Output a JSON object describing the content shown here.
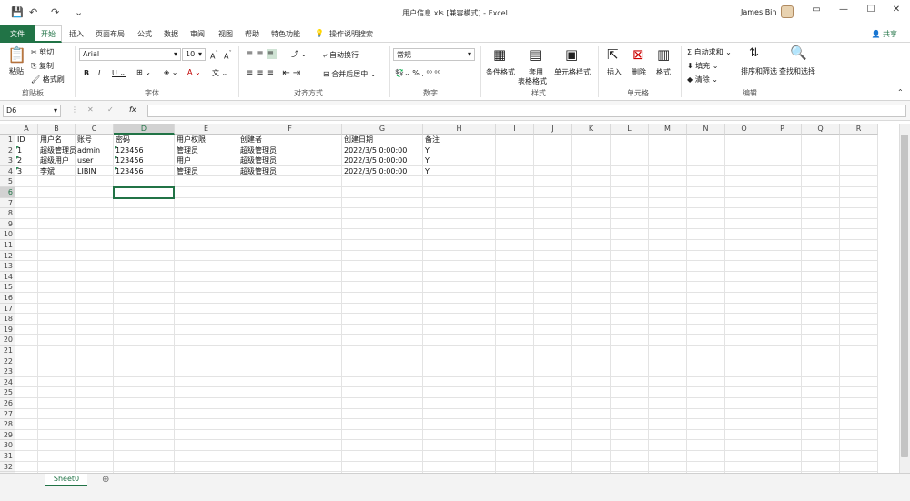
{
  "window": {
    "title": "用户信息.xls  [兼容模式]  -  Excel",
    "user": "James Bin",
    "controls": [
      "▭",
      "—",
      "☐",
      "✕"
    ]
  },
  "quick_access": [
    "💾",
    "↶",
    "↷",
    "⌄"
  ],
  "menu": {
    "file": "文件",
    "home": "开始",
    "tabs": [
      "插入",
      "页面布局",
      "公式",
      "数据",
      "审阅",
      "视图",
      "帮助",
      "特色功能"
    ],
    "search": "操作说明搜索",
    "share": "共享"
  },
  "ribbon": {
    "clipboard": {
      "paste": "粘贴",
      "cut": "剪切",
      "copy": "复制",
      "format_painter": "格式刷",
      "label": "剪贴板"
    },
    "font": {
      "name": "Arial",
      "size": "10",
      "label": "字体"
    },
    "alignment": {
      "wrap": "自动换行",
      "merge": "合并后居中",
      "label": "对齐方式"
    },
    "number": {
      "format": "常规",
      "label": "数字"
    },
    "styles": {
      "conditional": "条件格式",
      "table_line1": "套用",
      "table_line2": "表格格式",
      "cell_styles": "单元格样式",
      "label": "样式"
    },
    "cells": {
      "insert": "插入",
      "delete": "删除",
      "format": "格式",
      "label": "单元格"
    },
    "editing": {
      "autosum": "自动求和",
      "fill": "填充",
      "clear": "清除",
      "sort": "排序和筛选",
      "find": "查找和选择",
      "label": "编辑"
    }
  },
  "formula_bar": {
    "name_box": "D6",
    "cancel": "✕",
    "enter": "✓",
    "fx": "fx",
    "content": ""
  },
  "columns": [
    "A",
    "B",
    "C",
    "D",
    "E",
    "F",
    "G",
    "H",
    "I",
    "J",
    "K",
    "L",
    "M",
    "N",
    "O",
    "P",
    "Q",
    "R"
  ],
  "selected_cell": {
    "column": "D",
    "row": 6
  },
  "table": {
    "headers": [
      "ID",
      "用户名",
      "账号",
      "密码",
      "用户权限",
      "创建者",
      "创建日期",
      "备注"
    ],
    "rows": [
      [
        "1",
        "超级管理员",
        "admin",
        "123456",
        "管理员",
        "超级管理员",
        "2022/3/5 0:00:00",
        "Y"
      ],
      [
        "2",
        "超级用户",
        "user",
        "123456",
        "用户",
        "超级管理员",
        "2022/3/5 0:00:00",
        "Y"
      ],
      [
        "3",
        "李斌",
        "LIBIN",
        "123456",
        "管理员",
        "超级管理员",
        "2022/3/5 0:00:00",
        "Y"
      ]
    ]
  },
  "sheet_tab": "Sheet0",
  "add_sheet": "⊕"
}
